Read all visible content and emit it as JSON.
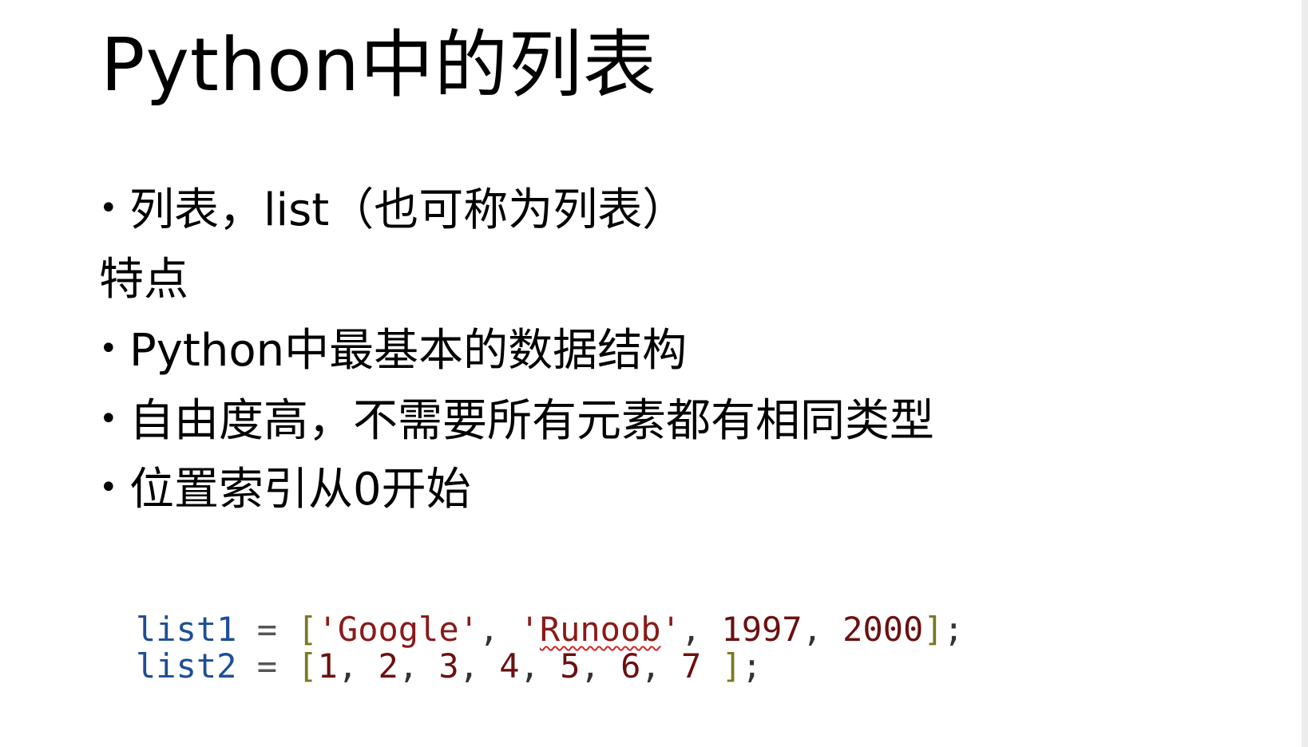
{
  "title": "Python中的列表",
  "bullets": {
    "b1": "列表，list（也可称为列表）",
    "heading": "特点",
    "b2": "Python中最基本的数据结构",
    "b3": "自由度高，不需要所有元素都有相同类型",
    "b4": "位置索引从0开始",
    "bullet_char": "•"
  },
  "code": {
    "line1": {
      "var": "list1",
      "eq": "=",
      "open": "[",
      "s1": "'Google'",
      "comma1": ",",
      "s2_quote_open": "'",
      "s2_word": "Runoob",
      "s2_quote_close": "'",
      "comma2": ",",
      "n1": "1997",
      "comma3": ",",
      "n2": "2000",
      "close": "]",
      "semi": ";"
    },
    "line2": {
      "var": "list2",
      "eq": "=",
      "open": "[",
      "n1": "1",
      "n2": "2",
      "n3": "3",
      "n4": "4",
      "n5": "5",
      "n6": "6",
      "n7": "7",
      "comma": ",",
      "close": "]",
      "semi": ";"
    }
  },
  "colors": {
    "keyword": "#1f4e96",
    "string": "#8b1a1a",
    "number": "#6b1010",
    "bracket": "#7a7a20",
    "spellcheck": "#dd2222"
  }
}
